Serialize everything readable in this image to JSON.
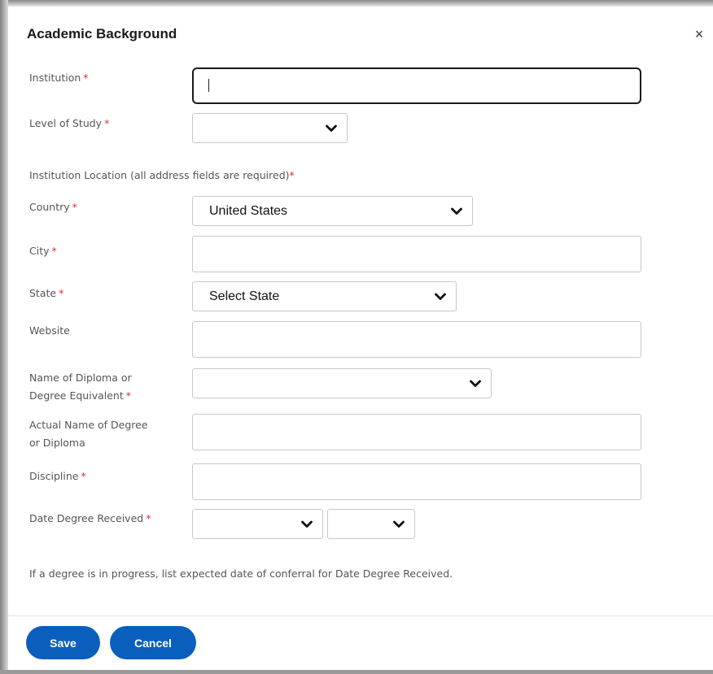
{
  "dialog": {
    "title": "Academic Background",
    "close_symbol": "×"
  },
  "required_marker": "*",
  "fields": {
    "institution": {
      "label": "Institution",
      "value": ""
    },
    "level_of_study": {
      "label": "Level of Study",
      "value": ""
    },
    "location_heading": "Institution Location (all address fields are required)",
    "country": {
      "label": "Country",
      "value": "United States"
    },
    "city": {
      "label": "City",
      "value": ""
    },
    "state": {
      "label": "State",
      "value": "Select State"
    },
    "website": {
      "label": "Website",
      "value": ""
    },
    "diploma_name": {
      "label_line1": "Name of Diploma or",
      "label_line2": "Degree Equivalent",
      "value": ""
    },
    "actual_name": {
      "label_line1": "Actual Name of Degree",
      "label_line2": "or Diploma",
      "value": ""
    },
    "discipline": {
      "label": "Discipline",
      "value": ""
    },
    "date_received": {
      "label": "Date Degree Received",
      "month_value": "",
      "year_value": ""
    }
  },
  "note": "If a degree is in progress, list expected date of conferral for Date Degree Received.",
  "buttons": {
    "save": "Save",
    "cancel": "Cancel"
  },
  "colors": {
    "accent": "#0a5fbd",
    "required": "#d9302c"
  }
}
